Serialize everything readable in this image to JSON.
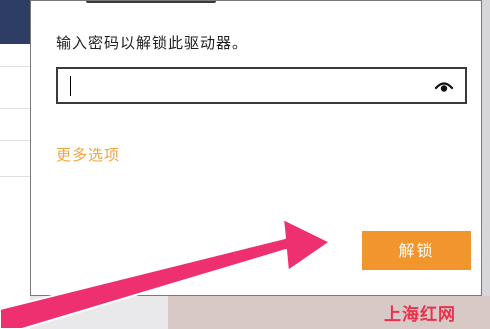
{
  "dialog": {
    "prompt": "输入密码以解锁此驱动器。",
    "password": {
      "value": ""
    },
    "more_options": "更多选项",
    "unlock_label": "解锁"
  },
  "icons": {
    "show_password": "eye-icon"
  },
  "watermark": "上海红网",
  "colors": {
    "accent": "#f1952c",
    "link": "#f0a541",
    "annotation_arrow": "#ee2f70",
    "titlebar": "#2d3d64"
  }
}
